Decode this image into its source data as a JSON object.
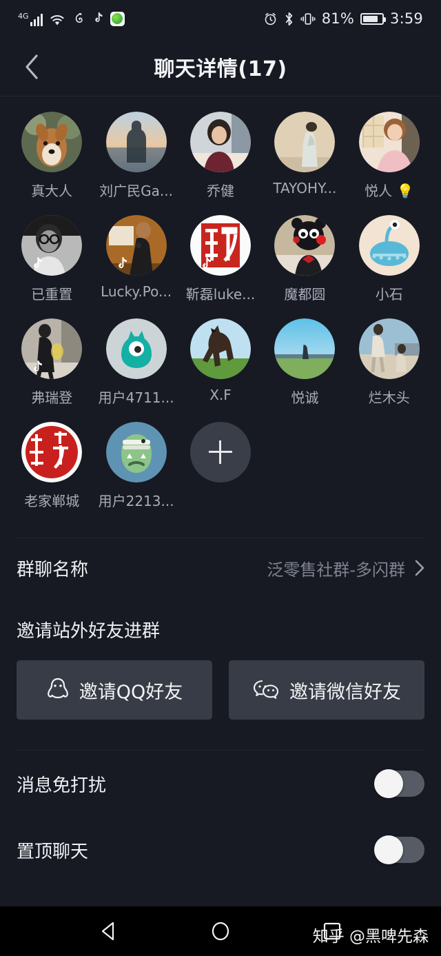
{
  "statusbar": {
    "network_label": "4G",
    "battery_percent": "81%",
    "time": "3:59",
    "left_icons": [
      "signal-4g-icon",
      "wifi-icon",
      "netease-music-icon",
      "douyin-icon",
      "green-app-icon"
    ],
    "right_icons": [
      "alarm-icon",
      "bluetooth-icon",
      "vibrate-icon",
      "battery-icon"
    ]
  },
  "titlebar": {
    "back_icon": "chevron-left-icon",
    "title": "聊天详情(17)"
  },
  "members": [
    {
      "name": "真大人",
      "avatar": "dog-photo",
      "badge": false
    },
    {
      "name": "刘广民Ga...",
      "avatar": "sunset-silhouette",
      "badge": false
    },
    {
      "name": "乔健",
      "avatar": "woman-photo",
      "badge": false
    },
    {
      "name": "TAYOHY...",
      "avatar": "painting-woman",
      "badge": false
    },
    {
      "name": "悦人 💡",
      "avatar": "retro-woman",
      "badge": false
    },
    {
      "name": "已重置",
      "avatar": "bw-man-glasses",
      "badge": true
    },
    {
      "name": "Lucky.Po...",
      "avatar": "speaker-man",
      "badge": true
    },
    {
      "name": "靳磊luke...",
      "avatar": "red-seal",
      "badge": true
    },
    {
      "name": "魔都圆",
      "avatar": "kumamon",
      "badge": false
    },
    {
      "name": "小石",
      "avatar": "blue-creature",
      "badge": false
    },
    {
      "name": "弗瑞登",
      "avatar": "street-walk",
      "badge": true
    },
    {
      "name": "用户4711...",
      "avatar": "teal-monster",
      "badge": false
    },
    {
      "name": "X.F",
      "avatar": "horse",
      "badge": false
    },
    {
      "name": "悦诚",
      "avatar": "field-person",
      "badge": false
    },
    {
      "name": "烂木头",
      "avatar": "beach-family",
      "badge": false
    },
    {
      "name": "老家郸城",
      "avatar": "red-seal-2",
      "badge": false
    },
    {
      "name": "用户2213...",
      "avatar": "green-monster",
      "badge": false
    }
  ],
  "add_member": {
    "icon": "plus-icon",
    "label": ""
  },
  "group_name_row": {
    "label": "群聊名称",
    "value": "泛零售社群-多闪群",
    "chevron": "chevron-right-icon"
  },
  "invite": {
    "section_title": "邀请站外好友进群",
    "buttons": [
      {
        "label": "邀请QQ好友",
        "icon": "qq-penguin-icon"
      },
      {
        "label": "邀请微信好友",
        "icon": "wechat-icon"
      }
    ]
  },
  "settings": [
    {
      "label": "消息免打扰",
      "toggle": "off"
    },
    {
      "label": "置顶聊天",
      "toggle": "off"
    }
  ],
  "navbar": {
    "back_icon": "triangle-back-icon",
    "home_icon": "circle-home-icon",
    "recents_icon": "square-recents-icon",
    "watermark": "知乎 @黑啤先森"
  },
  "colors": {
    "background": "#171a23",
    "navbar": "#000000",
    "button": "#383c46",
    "text_primary": "#f2f3f5",
    "text_secondary": "#a9adb8",
    "divider": "#23262f",
    "toggle_track": "#565b66"
  }
}
